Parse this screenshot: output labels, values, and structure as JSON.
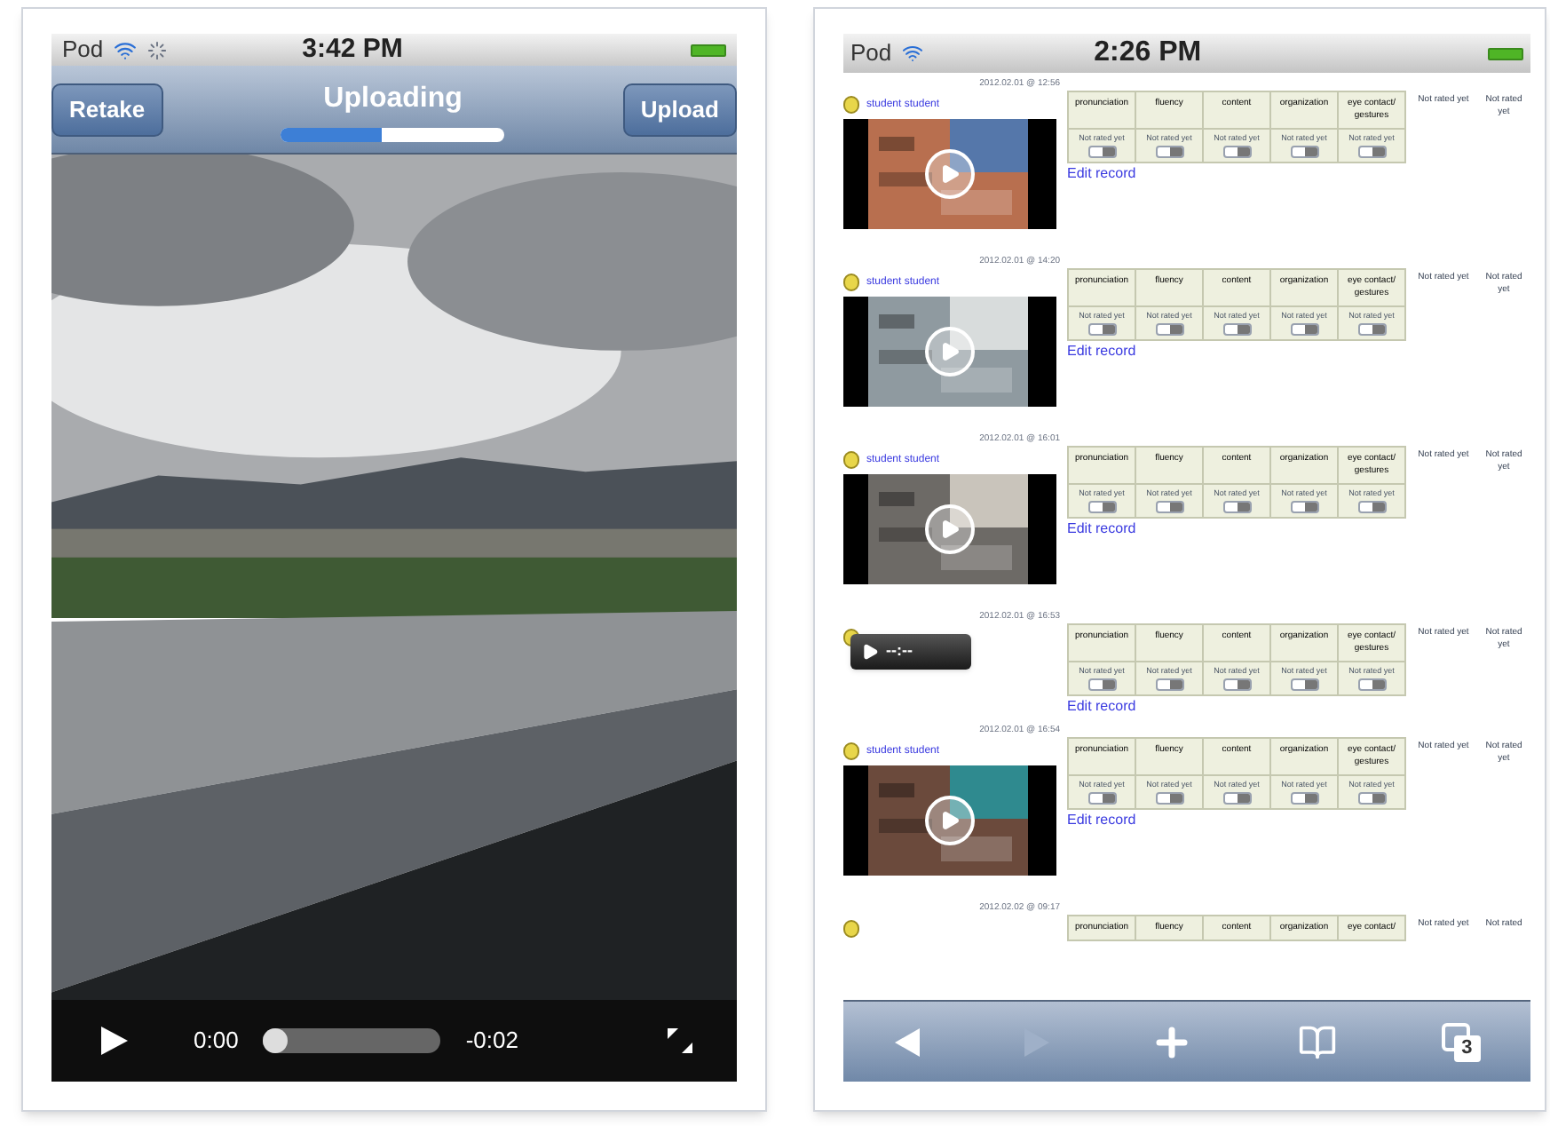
{
  "left_phone": {
    "status": {
      "carrier": "Pod",
      "time": "3:42 PM"
    },
    "nav": {
      "left_button": "Retake",
      "title": "Uploading",
      "right_button": "Upload",
      "progress": {
        "level": 0.45
      }
    },
    "controls": {
      "elapsed": "0:00",
      "remaining": "-0:02",
      "scrubber": {
        "level": 0
      }
    }
  },
  "right_phone": {
    "status": {
      "carrier": "Pod",
      "time": "2:26 PM"
    },
    "records": [
      {
        "timestamp": "2012.02.01 @ 12:56",
        "author": "student student",
        "media": {
          "kind": "video"
        },
        "criteria": [
          {
            "name": "pronunciation",
            "rating": "Not rated yet",
            "on": false
          },
          {
            "name": "fluency",
            "rating": "Not rated yet",
            "on": false
          },
          {
            "name": "content",
            "rating": "Not rated yet",
            "on": false
          },
          {
            "name": "organization",
            "rating": "Not rated yet",
            "on": false
          },
          {
            "name": "eye contact/ gestures",
            "rating": "Not rated yet",
            "on": false
          }
        ],
        "edit_link": "Edit record",
        "overall": [
          "Not rated yet",
          "Not rated yet"
        ]
      },
      {
        "timestamp": "2012.02.01 @ 14:20",
        "author": "student student",
        "media": {
          "kind": "video"
        },
        "criteria": [
          {
            "name": "pronunciation",
            "rating": "Not rated yet",
            "on": false
          },
          {
            "name": "fluency",
            "rating": "Not rated yet",
            "on": false
          },
          {
            "name": "content",
            "rating": "Not rated yet",
            "on": false
          },
          {
            "name": "organization",
            "rating": "Not rated yet",
            "on": false
          },
          {
            "name": "eye contact/ gestures",
            "rating": "Not rated yet",
            "on": false
          }
        ],
        "edit_link": "Edit record",
        "overall": [
          "Not rated yet",
          "Not rated yet"
        ]
      },
      {
        "timestamp": "2012.02.01 @ 16:01",
        "author": "student student",
        "media": {
          "kind": "video"
        },
        "criteria": [
          {
            "name": "pronunciation",
            "rating": "Not rated yet",
            "on": false
          },
          {
            "name": "fluency",
            "rating": "Not rated yet",
            "on": false
          },
          {
            "name": "content",
            "rating": "Not rated yet",
            "on": false
          },
          {
            "name": "organization",
            "rating": "Not rated yet",
            "on": false
          },
          {
            "name": "eye contact/ gestures",
            "rating": "Not rated yet",
            "on": false
          }
        ],
        "edit_link": "Edit record",
        "overall": [
          "Not rated yet",
          "Not rated yet"
        ]
      },
      {
        "timestamp": "2012.02.01 @ 16:53",
        "media": {
          "kind": "audio",
          "time": "--:--"
        },
        "criteria": [
          {
            "name": "pronunciation",
            "rating": "Not rated yet",
            "on": false
          },
          {
            "name": "fluency",
            "rating": "Not rated yet",
            "on": false
          },
          {
            "name": "content",
            "rating": "Not rated yet",
            "on": false
          },
          {
            "name": "organization",
            "rating": "Not rated yet",
            "on": false
          },
          {
            "name": "eye contact/ gestures",
            "rating": "Not rated yet",
            "on": false
          }
        ],
        "edit_link": "Edit record",
        "overall": [
          "Not rated yet",
          "Not rated yet"
        ]
      },
      {
        "timestamp": "2012.02.01 @ 16:54",
        "author": "student student",
        "media": {
          "kind": "video"
        },
        "criteria": [
          {
            "name": "pronunciation",
            "rating": "Not rated yet",
            "on": false
          },
          {
            "name": "fluency",
            "rating": "Not rated yet",
            "on": false
          },
          {
            "name": "content",
            "rating": "Not rated yet",
            "on": false
          },
          {
            "name": "organization",
            "rating": "Not rated yet",
            "on": false
          },
          {
            "name": "eye contact/ gestures",
            "rating": "Not rated yet",
            "on": false
          }
        ],
        "edit_link": "Edit record",
        "overall": [
          "Not rated yet",
          "Not rated yet"
        ]
      },
      {
        "timestamp": "2012.02.02 @ 09:17",
        "media": {
          "kind": "none"
        },
        "criteria": [
          {
            "name": "pronunciation"
          },
          {
            "name": "fluency"
          },
          {
            "name": "content"
          },
          {
            "name": "organization"
          },
          {
            "name": "eye contact/"
          }
        ],
        "overall": [
          "Not rated yet",
          "Not rated"
        ]
      }
    ],
    "toolbar": {
      "back": {
        "disabled": false
      },
      "forward": {
        "disabled": true
      },
      "tab_count": "3"
    }
  }
}
